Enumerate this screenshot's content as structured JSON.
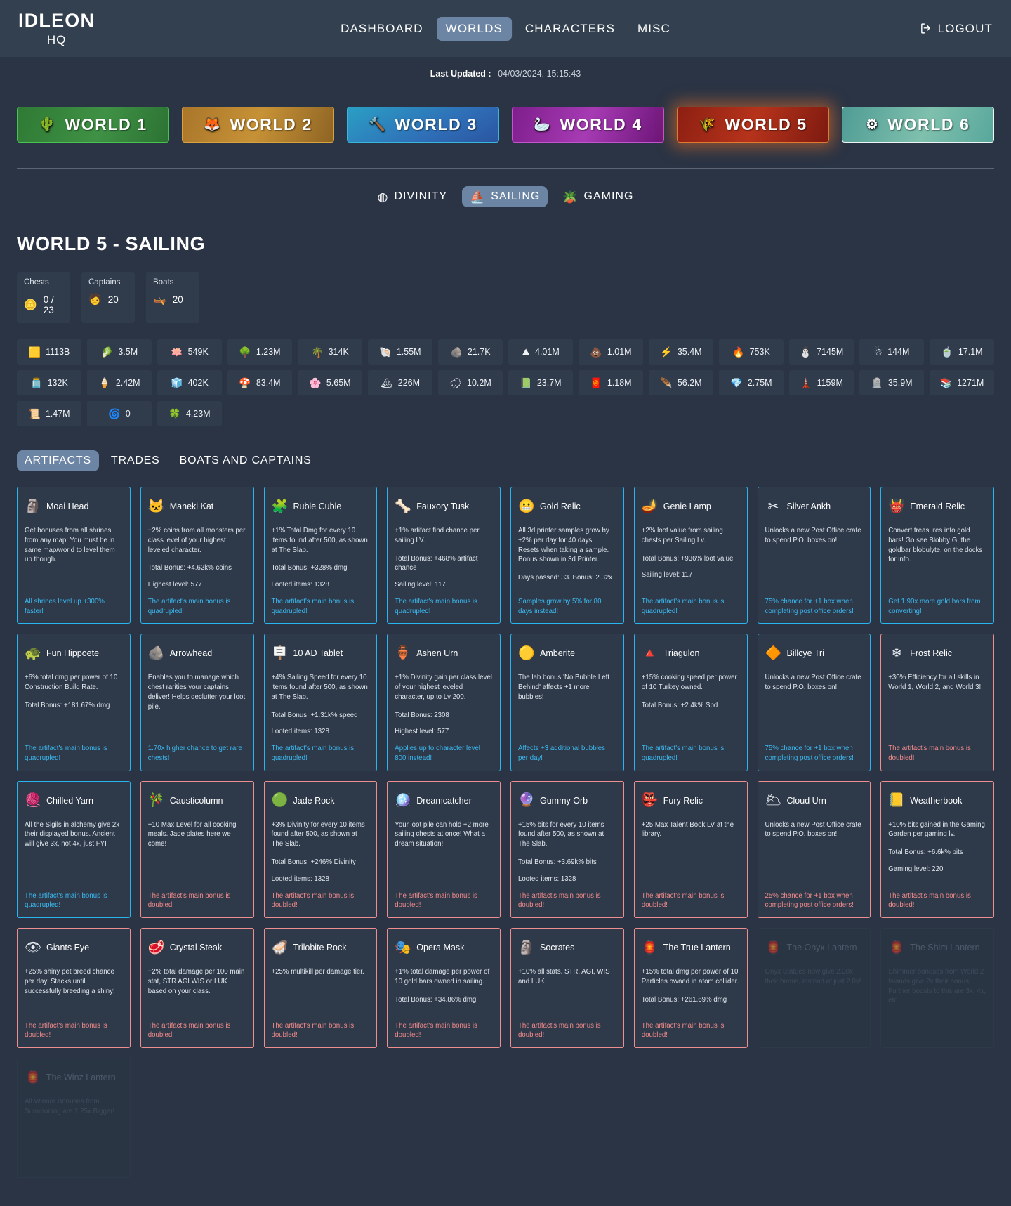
{
  "header": {
    "brand_line1": "IDLEON",
    "brand_line2": "HQ",
    "nav": [
      {
        "label": "DASHBOARD",
        "active": false
      },
      {
        "label": "WORLDS",
        "active": true
      },
      {
        "label": "CHARACTERS",
        "active": false
      },
      {
        "label": "MISC",
        "active": false
      }
    ],
    "logout_label": "LOGOUT"
  },
  "updated": {
    "label": "Last Updated :",
    "value": "04/03/2024, 15:15:43"
  },
  "worlds": [
    {
      "label": "WORLD 1",
      "icon": "🌵",
      "key": "w1",
      "active": false
    },
    {
      "label": "WORLD 2",
      "icon": "🦊",
      "key": "w2",
      "active": false
    },
    {
      "label": "WORLD 3",
      "icon": "🔨",
      "key": "w3",
      "active": false
    },
    {
      "label": "WORLD 4",
      "icon": "🦢",
      "key": "w4",
      "active": false
    },
    {
      "label": "WORLD 5",
      "icon": "🌾",
      "key": "w5",
      "active": true
    },
    {
      "label": "WORLD 6",
      "icon": "⚙",
      "key": "w6",
      "active": false
    }
  ],
  "subtabs": [
    {
      "label": "DIVINITY",
      "icon": "◍",
      "active": false
    },
    {
      "label": "SAILING",
      "icon": "⛵",
      "active": true
    },
    {
      "label": "GAMING",
      "icon": "🪴",
      "active": false
    }
  ],
  "page_title": "WORLD 5 - SAILING",
  "summary": [
    {
      "label": "Chests",
      "icon": "🪙",
      "value": "0 / 23"
    },
    {
      "label": "Captains",
      "icon": "🧑",
      "value": "20"
    },
    {
      "label": "Boats",
      "icon": "🛶",
      "value": "20"
    }
  ],
  "resources": [
    {
      "icon": "🟨",
      "value": "1113B",
      "name": "gold-bar"
    },
    {
      "icon": "🥬",
      "value": "3.5M",
      "name": "green-gem"
    },
    {
      "icon": "🪷",
      "value": "549K",
      "name": "coral"
    },
    {
      "icon": "🌳",
      "value": "1.23M",
      "name": "tree"
    },
    {
      "icon": "🌴",
      "value": "314K",
      "name": "palm"
    },
    {
      "icon": "🐚",
      "value": "1.55M",
      "name": "shell"
    },
    {
      "icon": "🪨",
      "value": "21.7K",
      "name": "pearl-rock"
    },
    {
      "icon": "⛰",
      "value": "4.01M",
      "name": "brown-peak"
    },
    {
      "icon": "💩",
      "value": "1.01M",
      "name": "mud-pile"
    },
    {
      "icon": "⚡",
      "value": "35.4M",
      "name": "bolt"
    },
    {
      "icon": "🔥",
      "value": "753K",
      "name": "flame-bolt"
    },
    {
      "icon": "⛄",
      "value": "7145M",
      "name": "snowman"
    },
    {
      "icon": "☃",
      "value": "144M",
      "name": "snowman-alt"
    },
    {
      "icon": "🍵",
      "value": "17.1M",
      "name": "green-vial"
    },
    {
      "icon": "🫙",
      "value": "132K",
      "name": "purple-jar"
    },
    {
      "icon": "🍦",
      "value": "2.42M",
      "name": "cotton-candy"
    },
    {
      "icon": "🧊",
      "value": "402K",
      "name": "blue-candy"
    },
    {
      "icon": "🍄",
      "value": "83.4M",
      "name": "mushroom"
    },
    {
      "icon": "🌸",
      "value": "5.65M",
      "name": "pink-sprout"
    },
    {
      "icon": "🏔",
      "value": "226M",
      "name": "iceberg"
    },
    {
      "icon": "🌧",
      "value": "10.2M",
      "name": "rain-cloud"
    },
    {
      "icon": "📗",
      "value": "23.7M",
      "name": "green-book"
    },
    {
      "icon": "🧧",
      "value": "1.18M",
      "name": "red-pack"
    },
    {
      "icon": "🪶",
      "value": "56.2M",
      "name": "red-feather"
    },
    {
      "icon": "💎",
      "value": "2.75M",
      "name": "diamond"
    },
    {
      "icon": "🗼",
      "value": "1159M",
      "name": "obelisk"
    },
    {
      "icon": "🪦",
      "value": "35.9M",
      "name": "statue"
    },
    {
      "icon": "📚",
      "value": "1271M",
      "name": "books"
    },
    {
      "icon": "📜",
      "value": "1.47M",
      "name": "scroll"
    },
    {
      "icon": "🌀",
      "value": "0",
      "name": "blue-sigil"
    },
    {
      "icon": "🍀",
      "value": "4.23M",
      "name": "green-sigil"
    }
  ],
  "artifact_tabs": [
    {
      "label": "ARTIFACTS",
      "active": true
    },
    {
      "label": "TRADES",
      "active": false
    },
    {
      "label": "BOATS AND CAPTAINS",
      "active": false
    }
  ],
  "artifacts": [
    {
      "name": "Moai Head",
      "icon": "🗿",
      "state": "blue",
      "desc": "Get bonuses from all shrines from any map! You must be in same map/world to level them up though.",
      "stats": [],
      "footer": "All shrines level up +300% faster!"
    },
    {
      "name": "Maneki Kat",
      "icon": "🐱",
      "state": "blue",
      "desc": "+2% coins from all monsters per class level of your highest leveled character.",
      "stats": [
        "Total Bonus: +4.62k% coins",
        "Highest level: 577"
      ],
      "footer": "The artifact's main bonus is quadrupled!"
    },
    {
      "name": "Ruble Cuble",
      "icon": "🧩",
      "state": "blue",
      "desc": "+1% Total Dmg for every 10 items found after 500, as shown at The Slab.",
      "stats": [
        "Total Bonus: +328% dmg",
        "Looted items: 1328"
      ],
      "footer": "The artifact's main bonus is quadrupled!"
    },
    {
      "name": "Fauxory Tusk",
      "icon": "🦴",
      "state": "blue",
      "desc": "+1% artifact find chance per sailing LV.",
      "stats": [
        "Total Bonus: +468% artifact chance",
        "Sailing level: 117"
      ],
      "footer": "The artifact's main bonus is quadrupled!"
    },
    {
      "name": "Gold Relic",
      "icon": "😬",
      "state": "blue",
      "desc": "All 3d printer samples grow by +2% per day for 40 days. Resets when taking a sample. Bonus shown in 3d Printer.",
      "stats": [
        "Days passed: 33. Bonus: 2.32x"
      ],
      "footer": "Samples grow by 5% for 80 days instead!"
    },
    {
      "name": "Genie Lamp",
      "icon": "🪔",
      "state": "blue",
      "desc": "+2% loot value from sailing chests per Sailing Lv.",
      "stats": [
        "Total Bonus: +936% loot value",
        "Sailing level: 117"
      ],
      "footer": "The artifact's main bonus is quadrupled!"
    },
    {
      "name": "Silver Ankh",
      "icon": "✂",
      "state": "blue",
      "desc": "Unlocks a new Post Office crate to spend P.O. boxes on!",
      "stats": [],
      "footer": "75% chance for +1 box when completing post office orders!"
    },
    {
      "name": "Emerald Relic",
      "icon": "👹",
      "state": "blue",
      "desc": "Convert treasures into gold bars! Go see Blobby G, the goldbar blobulyte, on the docks for info.",
      "stats": [],
      "footer": "Get 1.90x more gold bars from converting!"
    },
    {
      "name": "Fun Hippoete",
      "icon": "🐢",
      "state": "blue",
      "desc": "+6% total dmg per power of 10 Construction Build Rate.",
      "stats": [
        "Total Bonus: +181.67% dmg"
      ],
      "footer": "The artifact's main bonus is quadrupled!"
    },
    {
      "name": "Arrowhead",
      "icon": "🪨",
      "state": "blue",
      "desc": "Enables you to manage which chest rarities your captains deliver! Helps declutter your loot pile.",
      "stats": [],
      "footer": "1.70x higher chance to get rare chests!"
    },
    {
      "name": "10 AD Tablet",
      "icon": "🪧",
      "state": "blue",
      "desc": "+4% Sailing Speed for every 10 items found after 500, as shown at The Slab.",
      "stats": [
        "Total Bonus: +1.31k% speed",
        "Looted items: 1328"
      ],
      "footer": "The artifact's main bonus is quadrupled!"
    },
    {
      "name": "Ashen Urn",
      "icon": "🏺",
      "state": "blue",
      "desc": "+1% Divinity gain per class level of your highest leveled character, up to Lv 200.",
      "stats": [
        "Total Bonus: 2308",
        "Highest level: 577"
      ],
      "footer": "Applies up to character level 800 instead!"
    },
    {
      "name": "Amberite",
      "icon": "🟡",
      "state": "blue",
      "desc": "The lab bonus 'No Bubble Left Behind' affects +1 more bubbles!",
      "stats": [],
      "footer": "Affects +3 additional bubbles per day!"
    },
    {
      "name": "Triagulon",
      "icon": "🔺",
      "state": "blue",
      "desc": "+15% cooking speed per power of 10 Turkey owned.",
      "stats": [
        "Total Bonus: +2.4k% Spd"
      ],
      "footer": "The artifact's main bonus is quadrupled!"
    },
    {
      "name": "Billcye Tri",
      "icon": "🔶",
      "state": "blue",
      "desc": "Unlocks a new Post Office crate to spend P.O. boxes on!",
      "stats": [],
      "footer": "75% chance for +1 box when completing post office orders!"
    },
    {
      "name": "Frost Relic",
      "icon": "❄",
      "state": "red",
      "desc": "+30% Efficiency for all skills in World 1, World 2, and World 3!",
      "stats": [],
      "footer": "The artifact's main bonus is doubled!"
    },
    {
      "name": "Chilled Yarn",
      "icon": "🧶",
      "state": "blue",
      "desc": "All the Sigils in alchemy give 2x their displayed bonus. Ancient will give 3x, not 4x, just FYI",
      "stats": [],
      "footer": "The artifact's main bonus is quadrupled!"
    },
    {
      "name": "Causticolumn",
      "icon": "🎋",
      "state": "red",
      "desc": "+10 Max Level for all cooking meals. Jade plates here we come!",
      "stats": [],
      "footer": "The artifact's main bonus is doubled!"
    },
    {
      "name": "Jade Rock",
      "icon": "🟢",
      "state": "red",
      "desc": "+3% Divinity for every 10 items found after 500, as shown at The Slab.",
      "stats": [
        "Total Bonus: +246% Divinity",
        "Looted items: 1328"
      ],
      "footer": "The artifact's main bonus is doubled!"
    },
    {
      "name": "Dreamcatcher",
      "icon": "🪩",
      "state": "red",
      "desc": "Your loot pile can hold +2 more sailing chests at once! What a dream situation!",
      "stats": [],
      "footer": "The artifact's main bonus is doubled!"
    },
    {
      "name": "Gummy Orb",
      "icon": "🔮",
      "state": "red",
      "desc": "+15% bits for every 10 items found after 500, as shown at The Slab.",
      "stats": [
        "Total Bonus: +3.69k% bits",
        "Looted items: 1328"
      ],
      "footer": "The artifact's main bonus is doubled!"
    },
    {
      "name": "Fury Relic",
      "icon": "👺",
      "state": "red",
      "desc": "+25 Max Talent Book LV at the library.",
      "stats": [],
      "footer": "The artifact's main bonus is doubled!"
    },
    {
      "name": "Cloud Urn",
      "icon": "🌥",
      "state": "red",
      "desc": "Unlocks a new Post Office crate to spend P.O. boxes on!",
      "stats": [],
      "footer": "25% chance for +1 box when completing post office orders!"
    },
    {
      "name": "Weatherbook",
      "icon": "📒",
      "state": "red",
      "desc": "+10% bits gained in the Gaming Garden per gaming lv.",
      "stats": [
        "Total Bonus: +6.6k% bits",
        "Gaming level: 220"
      ],
      "footer": "The artifact's main bonus is doubled!"
    },
    {
      "name": "Giants Eye",
      "icon": "👁",
      "state": "red",
      "desc": "+25% shiny pet breed chance per day. Stacks until successfully breeding a shiny!",
      "stats": [],
      "footer": "The artifact's main bonus is doubled!"
    },
    {
      "name": "Crystal Steak",
      "icon": "🥩",
      "state": "red",
      "desc": "+2% total damage per 100 main stat, STR AGI WIS or LUK based on your class.",
      "stats": [],
      "footer": "The artifact's main bonus is doubled!"
    },
    {
      "name": "Trilobite Rock",
      "icon": "🦪",
      "state": "red",
      "desc": "+25% multikill per damage tier.",
      "stats": [],
      "footer": "The artifact's main bonus is doubled!"
    },
    {
      "name": "Opera Mask",
      "icon": "🎭",
      "state": "red",
      "desc": "+1% total damage per power of 10 gold bars owned in sailing.",
      "stats": [
        "Total Bonus: +34.86% dmg"
      ],
      "footer": "The artifact's main bonus is doubled!"
    },
    {
      "name": "Socrates",
      "icon": "🗿",
      "state": "red",
      "desc": "+10% all stats. STR, AGI, WIS and LUK.",
      "stats": [],
      "footer": "The artifact's main bonus is doubled!"
    },
    {
      "name": "The True Lantern",
      "icon": "🏮",
      "state": "red",
      "desc": "+15% total dmg per power of 10 Particles owned in atom collider.",
      "stats": [
        "Total Bonus: +261.69% dmg"
      ],
      "footer": "The artifact's main bonus is doubled!"
    },
    {
      "name": "The Onyx Lantern",
      "icon": "🏮",
      "state": "locked",
      "desc": "Onyx Statues now give 2.30x their bonus, instead of just 2.0x!",
      "stats": [],
      "footer": ""
    },
    {
      "name": "The Shim Lantern",
      "icon": "🏮",
      "state": "locked",
      "desc": "Shimmer bonuses from World 2 Islands give 2x their bonus! Further boosts to this are 3x, 4x, etc",
      "stats": [],
      "footer": ""
    },
    {
      "name": "The Winz Lantern",
      "icon": "🏮",
      "state": "locked",
      "desc": "All Winner Bonuses from Summoning are 1.25x Bigger!",
      "stats": [],
      "footer": ""
    }
  ]
}
